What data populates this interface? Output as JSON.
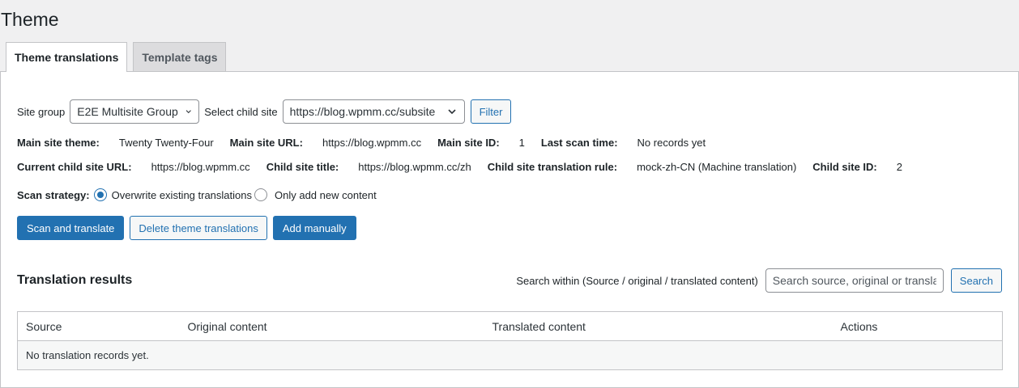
{
  "page": {
    "title": "Theme"
  },
  "tabs": [
    {
      "label": "Theme translations",
      "active": true
    },
    {
      "label": "Template tags",
      "active": false
    }
  ],
  "filter": {
    "site_group_label": "Site group",
    "site_group_value": "E2E Multisite Group",
    "child_site_label": "Select child site",
    "child_site_value": "https://blog.wpmm.cc/subsite",
    "filter_button": "Filter"
  },
  "info_row1": [
    {
      "label": "Main site theme:",
      "value": "Twenty Twenty-Four"
    },
    {
      "label": "Main site URL:",
      "value": "https://blog.wpmm.cc"
    },
    {
      "label": "Main site ID:",
      "value": "1"
    },
    {
      "label": "Last scan time:",
      "value": "No records yet"
    }
  ],
  "info_row2": [
    {
      "label": "Current child site URL:",
      "value": "https://blog.wpmm.cc"
    },
    {
      "label": "Child site title:",
      "value": "https://blog.wpmm.cc/zh"
    },
    {
      "label": "Child site translation rule:",
      "value": "mock-zh-CN (Machine translation)"
    },
    {
      "label": "Child site ID:",
      "value": "2"
    }
  ],
  "scan": {
    "label": "Scan strategy:",
    "options": [
      {
        "label": "Overwrite existing translations",
        "selected": true
      },
      {
        "label": "Only add new content",
        "selected": false
      }
    ]
  },
  "actions": {
    "scan": "Scan and translate",
    "delete": "Delete theme translations",
    "add": "Add manually"
  },
  "results": {
    "title": "Translation results",
    "search_label": "Search within (Source / original / translated content)",
    "search_placeholder": "Search source, original or translated content",
    "search_button": "Search",
    "columns": [
      "Source",
      "Original content",
      "Translated content",
      "Actions"
    ],
    "empty": "No translation records yet."
  },
  "colors": {
    "accent": "#2271b1",
    "background": "#f0f0f1",
    "border": "#c3c4c7"
  }
}
